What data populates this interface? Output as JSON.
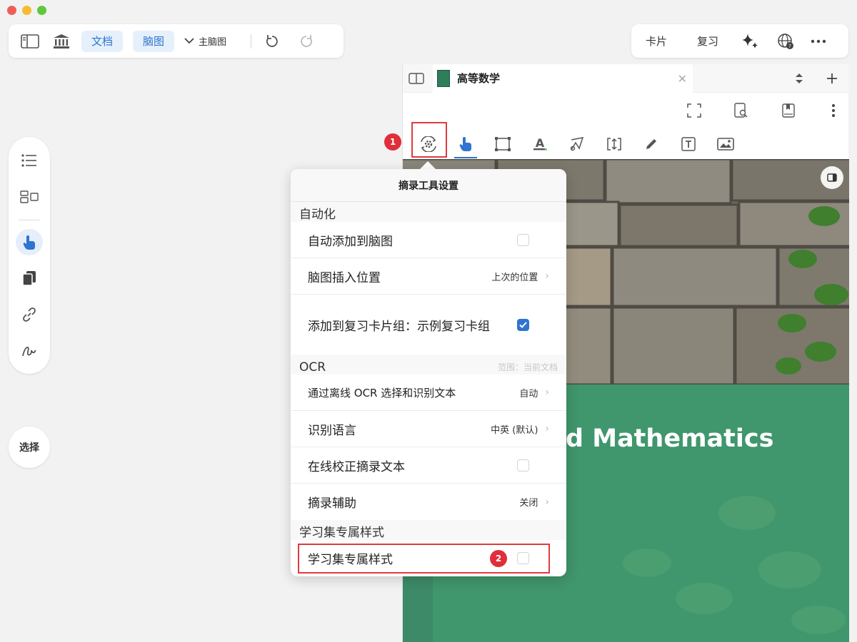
{
  "toolbar": {
    "doc_label": "文档",
    "mindmap_label": "脑图",
    "mindmap_select": "主脑图"
  },
  "top_right": {
    "card_label": "卡片",
    "review_label": "复习"
  },
  "left_rail": {
    "select_label": "选择"
  },
  "document": {
    "tab_title": "高等数学",
    "cover_title": "d Mathematics"
  },
  "popover": {
    "title": "摘录工具设置",
    "sections": {
      "automation": "自动化",
      "ocr": "OCR",
      "ocr_hint": "范围：当前文档",
      "study_style": "学习集专属样式"
    },
    "rows": {
      "auto_add": "自动添加到脑图",
      "insert_pos": "脑图插入位置",
      "insert_pos_val": "上次的位置",
      "add_review": "添加到复习卡片组：示例复习卡组",
      "offline_ocr": "通过离线 OCR 选择和识别文本",
      "offline_ocr_val": "自动",
      "language": "识别语言",
      "language_val": "中英 (默认)",
      "online_correct": "在线校正摘录文本",
      "assist": "摘录辅助",
      "assist_val": "关闭",
      "study_style": "学习集专属样式"
    }
  },
  "annotations": {
    "badge1": "1",
    "badge2": "2"
  }
}
